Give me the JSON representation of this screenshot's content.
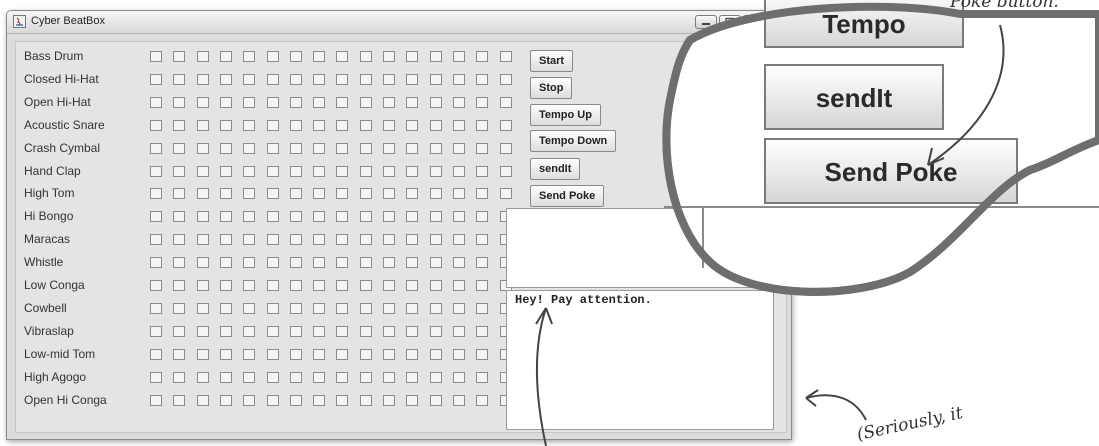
{
  "window": {
    "title": "Cyber BeatBox"
  },
  "instruments": [
    "Bass Drum",
    "Closed Hi-Hat",
    "Open Hi-Hat",
    "Acoustic Snare",
    "Crash Cymbal",
    "Hand Clap",
    "High Tom",
    "Hi Bongo",
    "Maracas",
    "Whistle",
    "Low Conga",
    "Cowbell",
    "Vibraslap",
    "Low-mid Tom",
    "High Agogo",
    "Open Hi Conga"
  ],
  "beats_per_row": 16,
  "buttons": {
    "start": "Start",
    "stop": "Stop",
    "tempo_up": "Tempo Up",
    "tempo_down": "Tempo Down",
    "sendit": "sendIt",
    "send_poke": "Send Poke"
  },
  "message_area": {
    "text": "Hey! Pay attention."
  },
  "magnifier": {
    "tempo_partial": "Tempo",
    "sendit": "sendIt",
    "send_poke": "Send Poke"
  },
  "annotations": {
    "top_right": "Poke button.",
    "bottom_right": "(Seriously, it"
  },
  "colors": {
    "window_bg": "#dcdcdc",
    "close_button": "#c0584a",
    "ink": "#333333"
  }
}
